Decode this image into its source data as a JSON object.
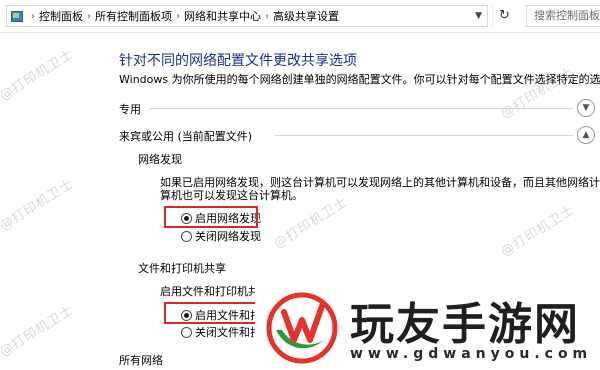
{
  "breadcrumb": {
    "items": [
      "控制面板",
      "所有控制面板项",
      "网络和共享中心",
      "高级共享设置"
    ],
    "separator": "›",
    "dropdown_icon": "chevron-down-icon"
  },
  "refresh_icon": "refresh-icon",
  "search": {
    "placeholder": "搜索控制面板"
  },
  "main": {
    "title": "针对不同的网络配置文件更改共享选项",
    "intro": "Windows 为你所使用的每个网络创建单独的网络配置文件。你可以针对每个配置文件选择特定的选项。"
  },
  "profiles": {
    "private": {
      "label": "专用",
      "state": "collapsed"
    },
    "guest_public": {
      "label": "来宾或公用 (当前配置文件)",
      "state": "expanded"
    },
    "all_networks": {
      "label": "所有网络"
    }
  },
  "network_discovery": {
    "title": "网络发现",
    "description": "如果已启用网络发现，则这台计算机可以发现网络上的其他计算机和设备，而且其他网络计算机也可以发现这台计算机。",
    "options": [
      {
        "label": "启用网络发现",
        "selected": true
      },
      {
        "label": "关闭网络发现",
        "selected": false
      }
    ]
  },
  "file_printer_sharing": {
    "title": "文件和打印机共享",
    "description": "启用文件和打印机共享",
    "options": [
      {
        "label": "启用文件和打印机共享",
        "selected": true
      },
      {
        "label": "关闭文件和打印机共享",
        "selected": false
      }
    ]
  },
  "watermark": {
    "text": "@打印机卫士"
  },
  "brand": {
    "name": "玩友手游网",
    "url": "www.gdwanyou.com"
  },
  "colors": {
    "title_blue": "#1e3287",
    "highlight_red": "#d9262b",
    "logo_red": "#e5322d",
    "logo_green": "#2b9a3a"
  }
}
